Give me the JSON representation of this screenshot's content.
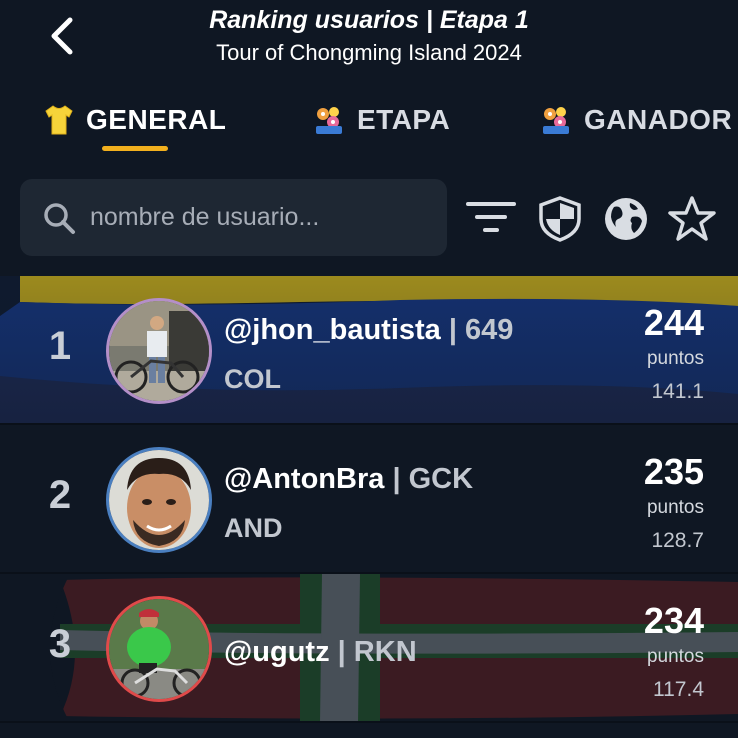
{
  "header": {
    "title": "Ranking usuarios | Etapa 1",
    "subtitle": "Tour of Chongming Island 2024"
  },
  "tabs": [
    {
      "label": "GENERAL",
      "icon": "yellow-jersey-icon",
      "active": true
    },
    {
      "label": "ETAPA",
      "icon": "flower-bouquet-icon",
      "active": false
    },
    {
      "label": "GANADOR",
      "icon": "flower-bouquet-icon",
      "active": false
    }
  ],
  "search": {
    "placeholder": "nombre de usuario..."
  },
  "toolbar": [
    "filter-icon",
    "shield-icon",
    "globe-icon",
    "star-icon"
  ],
  "colors": {
    "background": "#0f1723",
    "accent": "#f2b01e",
    "search_bg": "#1e2733"
  },
  "rankings": [
    {
      "rank": "1",
      "username": "@jhon_bautista",
      "team": "| 649",
      "country": "COL",
      "points": "244",
      "points_label": "puntos",
      "time": "141.1"
    },
    {
      "rank": "2",
      "username": "@AntonBra",
      "team": "| GCK",
      "country": "AND",
      "points": "235",
      "points_label": "puntos",
      "time": "128.7"
    },
    {
      "rank": "3",
      "username": "@ugutz",
      "team": "| RKN",
      "country": "",
      "points": "234",
      "points_label": "puntos",
      "time": "117.4"
    }
  ]
}
